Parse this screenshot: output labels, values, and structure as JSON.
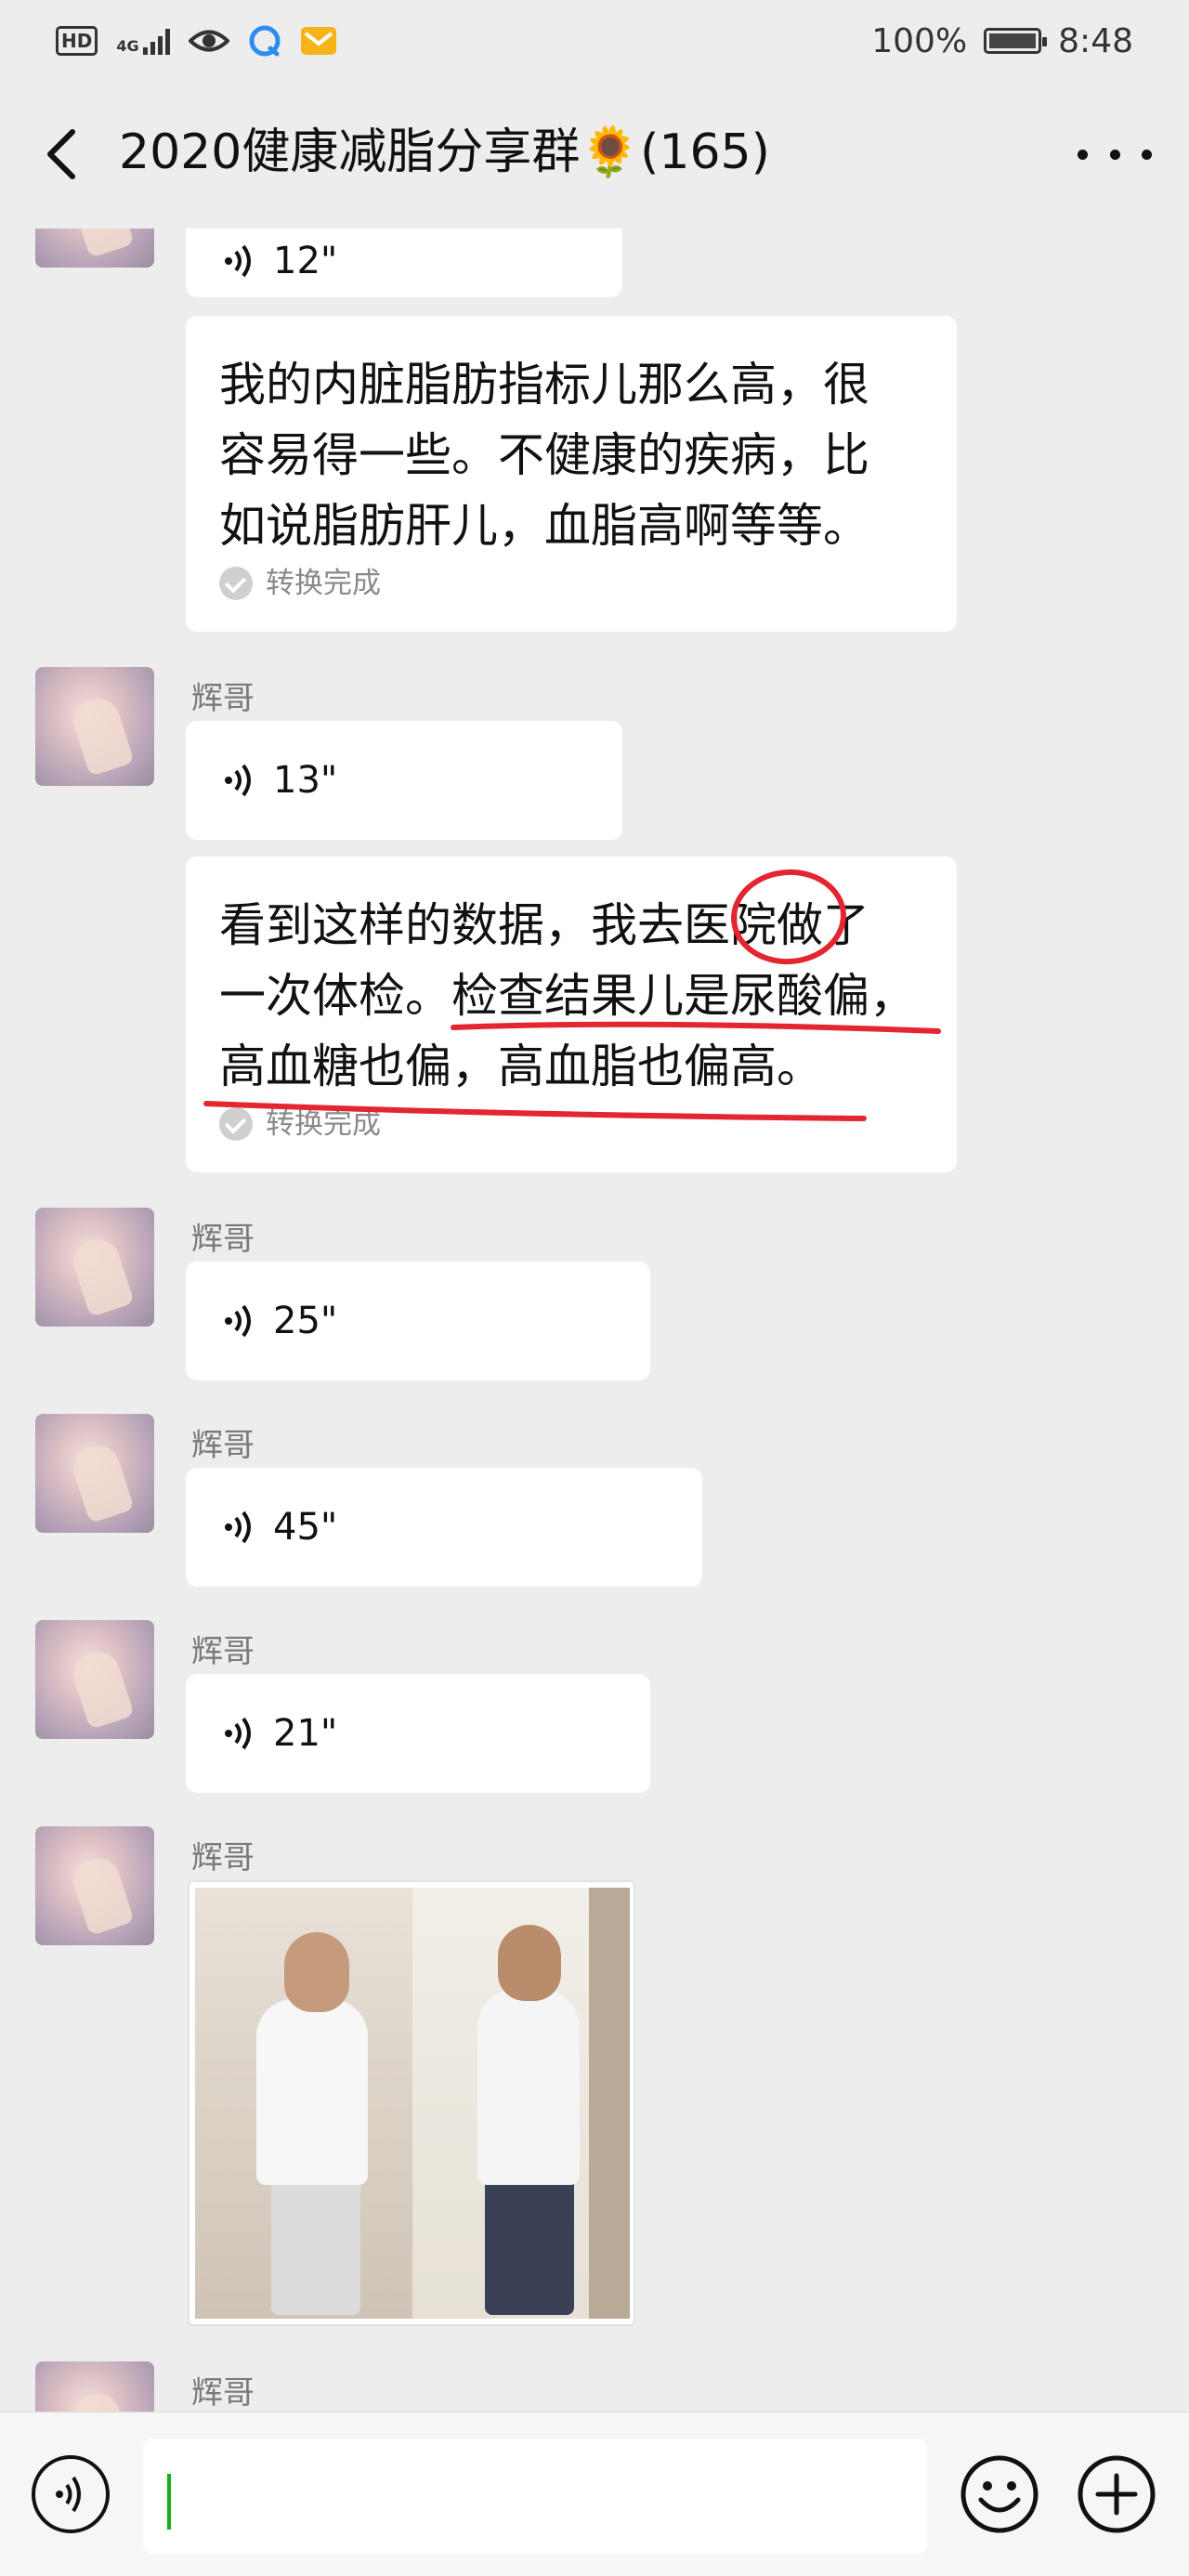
{
  "status_bar": {
    "hd": "HD",
    "network": "4G",
    "battery": "100%",
    "time": "8:48"
  },
  "header": {
    "title": "2020健康减脂分享群🌻(165)"
  },
  "messages": [
    {
      "type": "voice",
      "duration": "12\""
    },
    {
      "type": "transcript",
      "lines": [
        "我的内脏脂肪指标儿那么高，很",
        "容易得一些。不健康的疾病，比",
        "如说脂肪肝儿，血脂高啊等等。"
      ],
      "status": "转换完成"
    },
    {
      "type": "voice",
      "sender": "辉哥",
      "duration": "13\""
    },
    {
      "type": "transcript",
      "lines": [
        "看到这样的数据，我去医院做了",
        "一次体检。检查结果儿是尿酸偏，",
        "高血糖也偏，高血脂也偏高。"
      ],
      "status": "转换完成"
    },
    {
      "type": "voice",
      "sender": "辉哥",
      "duration": "25\""
    },
    {
      "type": "voice",
      "sender": "辉哥",
      "duration": "45\""
    },
    {
      "type": "voice",
      "sender": "辉哥",
      "duration": "21\""
    },
    {
      "type": "image",
      "sender": "辉哥"
    },
    {
      "type": "partial",
      "sender": "辉哥"
    }
  ],
  "colors": {
    "background": "#ededed",
    "bubble": "#ffffff",
    "annotation": "#e32630",
    "cursor": "#1aad19"
  },
  "icons": [
    "back-arrow-icon",
    "more-dots-icon",
    "voice-wave-icon",
    "check-icon",
    "voice-input-icon",
    "emoji-icon",
    "plus-icon"
  ]
}
